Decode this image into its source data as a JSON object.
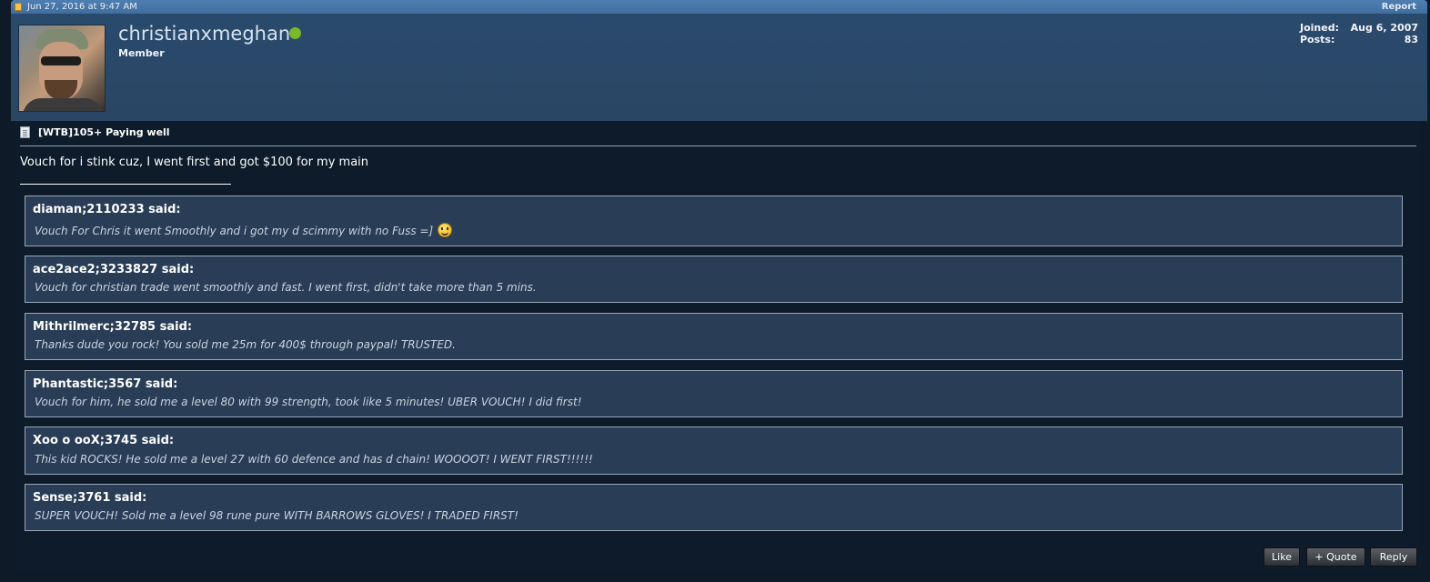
{
  "post_header": {
    "date": "Jun 27, 2016 at 9:47 AM",
    "report_label": "Report"
  },
  "user": {
    "name": "christianxmeghan",
    "title": "Member",
    "online": true,
    "joined_label": "Joined:",
    "joined_value": "Aug 6, 2007",
    "posts_label": "Posts:",
    "posts_value": "83"
  },
  "post": {
    "title": "[WTB]105+ Paying well",
    "message": "Vouch for i stink cuz, I went first and got $100 for my main",
    "quotes": [
      {
        "author": "diaman;2110233 said:",
        "text": "Vouch For Chris it went Smoothly and i got my d scimmy with no Fuss =]",
        "smiley": "grin-smiley"
      },
      {
        "author": "ace2ace2;3233827 said:",
        "text": "Vouch for christian trade went smoothly and fast. I went first, didn't take more than 5 mins."
      },
      {
        "author": "Mithrilmerc;32785 said:",
        "text": "Thanks dude you rock! You sold me 25m for 400$ through paypal! TRUSTED."
      },
      {
        "author": "Phantastic;3567 said:",
        "text": "Vouch for him, he sold me a level 80 with 99 strength, took like 5 minutes! UBER VOUCH! I did first!"
      },
      {
        "author": "Xoo o ooX;3745 said:",
        "text": "This kid ROCKS! He sold me a level 27 with 60 defence and has d chain! WOOOOT! I WENT FIRST!!!!!!"
      },
      {
        "author": "Sense;3761 said:",
        "text": "SUPER VOUCH! Sold me a level 98 rune pure WITH BARROWS GLOVES! I TRADED FIRST!"
      }
    ]
  },
  "actions": {
    "like": "Like",
    "quote": "+ Quote",
    "reply": "Reply"
  },
  "colors": {
    "header_blue": "#3f6e9f",
    "user_panel": "#2b4664",
    "post_background": "#0d1b2a",
    "quote_background": "#293d56",
    "online_green": "#79b82a"
  }
}
